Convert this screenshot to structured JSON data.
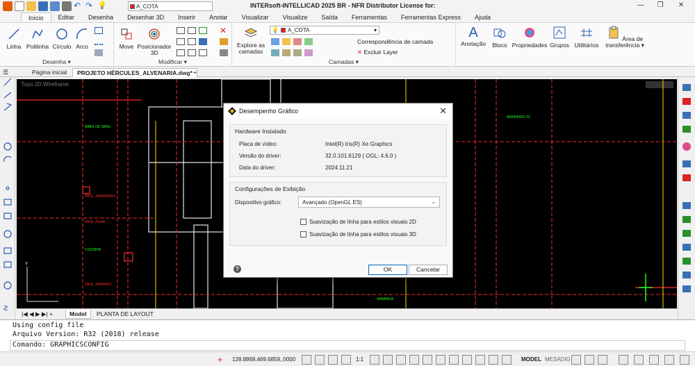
{
  "app": {
    "title": "INTERsoft-INTELLICAD 2025 BR - NFR Distributor License for:",
    "current_layer": "A_COTA",
    "colors": {
      "accent": "#0067c0",
      "canvas_bg": "#000000",
      "cad_red": "#ff2a2a",
      "cad_green": "#22ff22",
      "cad_yellow": "#ffd700"
    }
  },
  "window_controls": {
    "minimize": "—",
    "restore": "❐",
    "close": "✕"
  },
  "ribbon_tabs": [
    "Início",
    "Editar",
    "Desenha",
    "Desenhar 3D",
    "Inserir",
    "Anotar",
    "Visualizar",
    "Visualize",
    "Saída",
    "Ferramentas",
    "Ferramentas Express",
    "Ajuda"
  ],
  "ribbon": {
    "draw_group": {
      "label": "Desenha ▾",
      "tools": [
        "Linha",
        "Polilinha",
        "Círculo",
        "Arco"
      ]
    },
    "modify_group": {
      "label": "Modificar ▾",
      "move": "Move",
      "positioner": "Posicionador 3D"
    },
    "layers_group": {
      "label": "Camadas ▾",
      "explore": "Explore as camadas",
      "layer_combo": "A_COTA",
      "layer_match": "Correspondência de camada",
      "delete_layer": "Excluir Layer"
    },
    "right_tools": [
      "Anotação",
      "Bloco",
      "Propriedades",
      "Grupos",
      "Utilitários",
      "Área de transferência ▾"
    ]
  },
  "doc_tabs": {
    "home": "Página inicial",
    "active": "PROJETO HÉRCULES_ALVENARIA.dwg*",
    "add": "+"
  },
  "viewport_label": "Topo  2D Wireframe",
  "layout_tabs": {
    "model": "Model",
    "layout": "PLANTA DE LAYOUT",
    "nav": "|◀ ◀ ▶ ▶| +"
  },
  "command_history": [
    "Using config file",
    "Arquivo Version: R32 (2018) release"
  ],
  "command_prompt": "Comando: GRAPHICSCONFIG",
  "status": {
    "coords": "128.8869,469.6859,.0000",
    "scale": "1:1",
    "model": "MODEL",
    "style": "MESADIG"
  },
  "dialog": {
    "title": "Desempenho Gráfico",
    "hardware": {
      "legend": "Hardware Instalado",
      "rows": [
        {
          "label": "Placa de vídeo:",
          "value": "Intel(R) Iris(R) Xe Graphics"
        },
        {
          "label": "Versão do driver:",
          "value": "32.0.101.6129 ( OGL: 4.6.0 )"
        },
        {
          "label": "Data do driver:",
          "value": "2024.11.21"
        }
      ]
    },
    "display": {
      "legend": "Configurações de Exibição",
      "device_label": "Dispositivo gráfico:",
      "device_value": "Avançado (OpenGL ES)",
      "smoothing_2d": "Suavização de linha para estilos visuais 2D",
      "smoothing_3d": "Suavização de linha para estilos visuais 3D"
    },
    "ok": "OK",
    "cancel": "Cancelar"
  },
  "drawing_labels": [
    "ÁREA DE SERV.",
    "BANHEIRO 01",
    "PROJ. AMARRADO",
    "PROJ. PILAR",
    "COZINHA",
    "PROJ. ARMARIO",
    "VARANDA"
  ]
}
